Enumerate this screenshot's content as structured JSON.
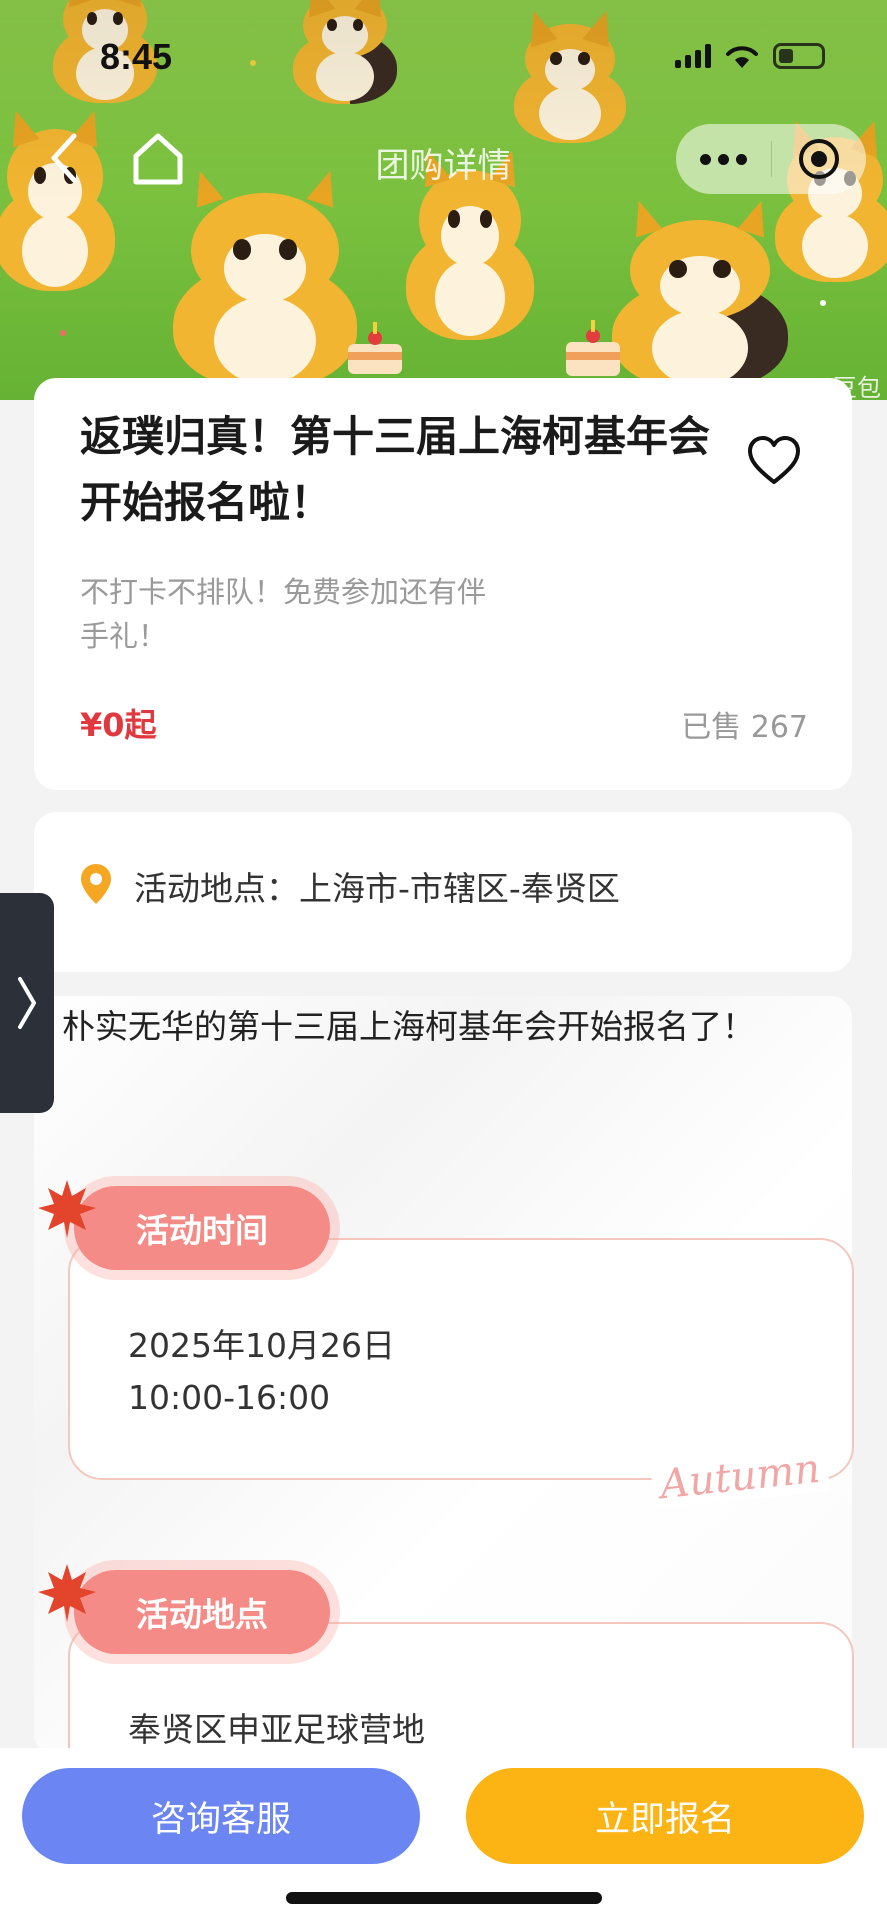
{
  "status_bar": {
    "time": "8:45"
  },
  "nav": {
    "title": "团购详情",
    "back_icon": "chevron-left-icon",
    "home_icon": "home-icon",
    "more_icon": "more-dots-icon",
    "target_icon": "target-icon"
  },
  "hero": {
    "watermark": "豆包"
  },
  "product": {
    "title": "返璞归真！第十三届上海柯基年会开始报名啦！",
    "subtitle": "不打卡不排队！免费参加还有伴手礼！",
    "price": "¥0起",
    "sold": "已售 267"
  },
  "location_card": {
    "text": "活动地点：上海市-市辖区-奉贤区"
  },
  "description": {
    "intro": "朴实无华的第十三届上海柯基年会开始报名了！",
    "blocks": [
      {
        "label": "活动时间",
        "lines": [
          "2025年10月26日",
          "10:00-16:00"
        ]
      },
      {
        "label": "活动地点",
        "lines": [
          "奉贤区申亚足球营地"
        ]
      }
    ],
    "autumn_text": "Autumn"
  },
  "bottom_bar": {
    "consult_label": "咨询客服",
    "signup_label": "立即报名"
  },
  "colors": {
    "price_red": "#e0383e",
    "consult_blue": "#6b86f2",
    "signup_orange": "#fbb414",
    "pill_pink": "#f58b86",
    "pin_orange": "#f5a623"
  }
}
